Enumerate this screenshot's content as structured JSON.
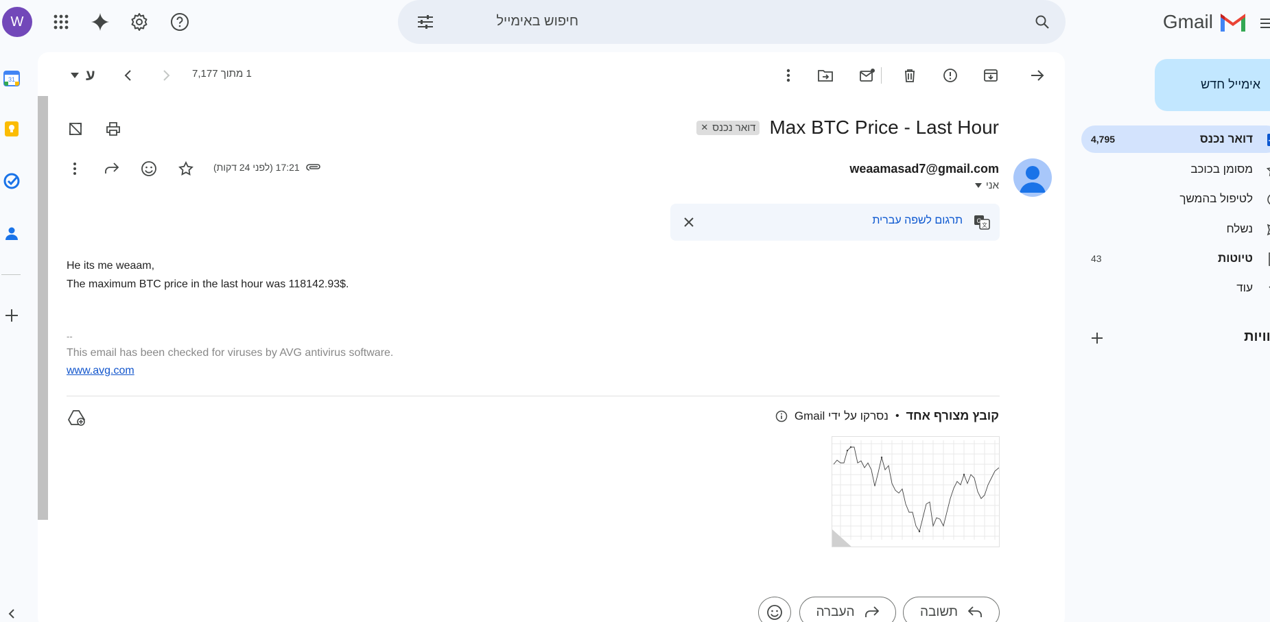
{
  "app": {
    "logo_text": "Gmail",
    "avatar_letter": "W"
  },
  "search": {
    "placeholder": "חיפוש באימייל"
  },
  "sidebar": {
    "compose_label": "אימייל חדש",
    "items": [
      {
        "label": "דואר נכנס",
        "count": "4,795",
        "active": true
      },
      {
        "label": "מסומן בכוכב",
        "count": ""
      },
      {
        "label": "לטיפול בהמשך",
        "count": ""
      },
      {
        "label": "נשלח",
        "count": ""
      },
      {
        "label": "טיוטות",
        "count": "43"
      },
      {
        "label": "עוד",
        "count": ""
      }
    ],
    "labels_heading": "תוויות"
  },
  "toolbar": {
    "pagination": "1 מתוך 7,177",
    "input_tool": "ע"
  },
  "email": {
    "subject": "Max BTC Price - Last Hour",
    "label_chip": "דואר נכנס",
    "sender": "weaamasad7@gmail.com",
    "to": "אני",
    "time": "17:21 (לפני 24 דקות)",
    "translate_label": "תרגום לשפה עברית",
    "body_line1": "He its me weaam,",
    "body_line2": "The maximum BTC price in the last hour was 118142.93$.",
    "sig_dash": "--",
    "sig_text": "This email has been checked for viruses by AVG antivirus software.",
    "sig_link": "www.avg.com"
  },
  "attachments": {
    "title": "קובץ מצורף אחד",
    "scanned": "נסרקו על ידי Gmail"
  },
  "actions": {
    "reply": "תשובה",
    "forward": "העברה"
  },
  "colors": {
    "accent": "#0b57d0",
    "compose_bg": "#c2e7ff",
    "active_bg": "#d3e3fd",
    "avatar": "#7248b9"
  }
}
